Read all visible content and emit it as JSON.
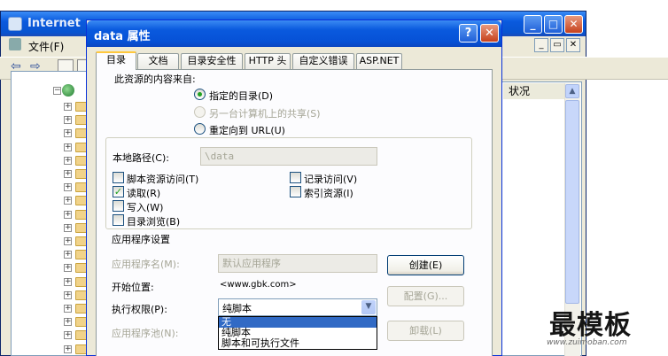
{
  "background_window": {
    "title": "Internet",
    "menu_file": "文件(F)",
    "list_column_header": "状况"
  },
  "dialog": {
    "title": "data 属性",
    "help_label": "?",
    "close_label": "✕",
    "tabs": [
      {
        "label": "目录",
        "active": true
      },
      {
        "label": "文档",
        "active": false
      },
      {
        "label": "目录安全性",
        "active": false
      },
      {
        "label": "HTTP 头",
        "active": false
      },
      {
        "label": "自定义错误",
        "active": false
      },
      {
        "label": "ASP.NET",
        "active": false
      }
    ],
    "source_heading": "此资源的内容来自:",
    "source_options": [
      {
        "label": "指定的目录(D)",
        "checked": true,
        "enabled": true
      },
      {
        "label": "另一台计算机上的共享(S)",
        "checked": false,
        "enabled": false
      },
      {
        "label": "重定向到 URL(U)",
        "checked": false,
        "enabled": true
      }
    ],
    "local_path_label": "本地路径(C):",
    "local_path_value": "\\data",
    "permissions": [
      {
        "label": "脚本资源访问(T)",
        "checked": false
      },
      {
        "label": "读取(R)",
        "checked": true
      },
      {
        "label": "写入(W)",
        "checked": false
      },
      {
        "label": "目录浏览(B)",
        "checked": false
      },
      {
        "label": "记录访问(V)",
        "checked": false
      },
      {
        "label": "索引资源(I)",
        "checked": false
      }
    ],
    "app_settings_heading": "应用程序设置",
    "app_name_label": "应用程序名(M):",
    "app_name_value": "默认应用程序",
    "create_button": "创建(E)",
    "start_location_label": "开始位置:",
    "start_location_value": "<www.gbk.com>",
    "config_button": "配置(G)...",
    "exec_perm_label": "执行权限(P):",
    "exec_perm_value": "纯脚本",
    "exec_perm_options": [
      {
        "label": "无",
        "selected": true
      },
      {
        "label": "纯脚本",
        "selected": false
      },
      {
        "label": "脚本和可执行文件",
        "selected": false
      }
    ],
    "app_pool_label": "应用程序池(N):",
    "unload_button": "卸载(L)"
  },
  "watermark": {
    "text": "最模板",
    "url": "www.zuimoban.com"
  },
  "colors": {
    "titlebar_blue": "#0a5ade",
    "dialog_face": "#ece9d8",
    "selection_blue": "#316ac5",
    "check_green": "#21a121"
  }
}
